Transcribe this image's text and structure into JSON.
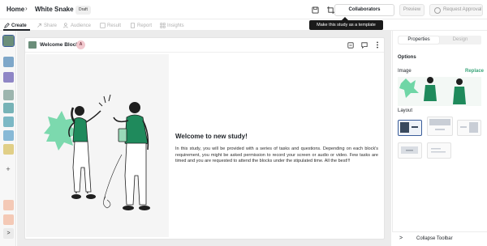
{
  "header": {
    "breadcrumb_home": "Home",
    "breadcrumb_sep": "›",
    "study_name": "White Snake",
    "status_badge": "Draft",
    "collaborators_label": "Collaborators",
    "preview_label": "Preview",
    "request_approval_label": "Request Approval",
    "tooltip": "Make this study as a template"
  },
  "tabs": [
    {
      "label": "Create",
      "icon": "pencil-icon",
      "active": true
    },
    {
      "label": "Share",
      "icon": "share-icon",
      "active": false
    },
    {
      "label": "Audience",
      "icon": "audience-icon",
      "active": false
    },
    {
      "label": "Result",
      "icon": "result-icon",
      "active": false
    },
    {
      "label": "Report",
      "icon": "report-icon",
      "active": false
    },
    {
      "label": "Insights",
      "icon": "insights-icon",
      "active": false
    }
  ],
  "rail": {
    "items": [
      {
        "name": "welcome-block-thumb",
        "color": "#6b8e7a"
      },
      {
        "name": "block-thumb-blue",
        "color": "#7ea7c9"
      },
      {
        "name": "block-thumb-purple",
        "color": "#8f86c6"
      },
      {
        "name": "block-thumb-stack",
        "color": "#9cb5ae"
      },
      {
        "name": "block-thumb-teal",
        "color": "#77b3b7"
      },
      {
        "name": "block-thumb-cyan",
        "color": "#7cb8c5"
      },
      {
        "name": "block-thumb-lightblue",
        "color": "#88b9d6"
      },
      {
        "name": "block-thumb-yellow",
        "color": "#e1cf87"
      }
    ],
    "add_label": "+",
    "bottom_icons": [
      "brush-icon",
      "filter-icon"
    ],
    "expand_label": ">"
  },
  "block": {
    "title": "Welcome Block",
    "avatar_initial": "A",
    "heading": "Welcome to new study!",
    "body": "In this study, you will be provided with a series of tasks and questions. Depending on each block's requirement, you might be asked permission to record your screen or audio or video. Few tasks are timed and you are requested to attend the blocks under the stipulated time. All the best!!!"
  },
  "panel": {
    "tab_properties": "Properties",
    "tab_design": "Design",
    "options_heading": "Options",
    "image_label": "Image",
    "replace_label": "Replace",
    "layout_label": "Layout",
    "collapse_label": "Collapse Toolbar",
    "collapse_chevron": ">"
  },
  "colors": {
    "accent_green": "#3aa57a",
    "illustration_green": "#1f8a5c",
    "selected_layout": "#3a5d9a"
  }
}
